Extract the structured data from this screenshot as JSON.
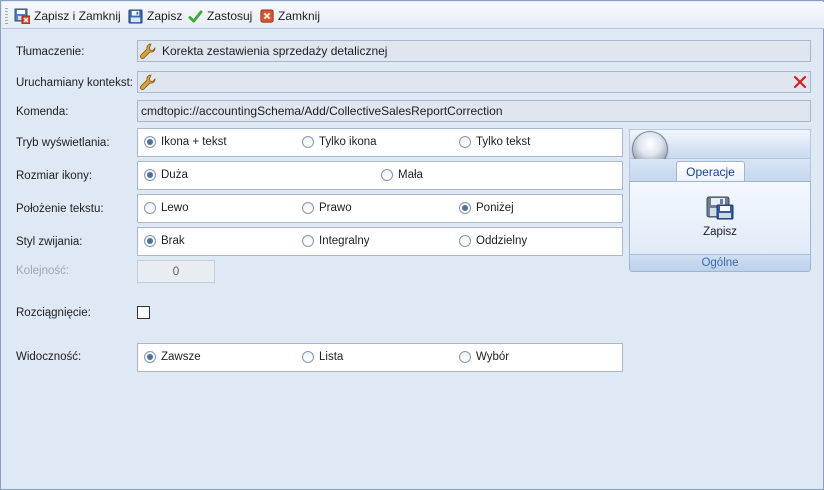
{
  "toolbar": {
    "items": [
      {
        "label": "Zapisz i Zamknij",
        "icon": "save-close-icon"
      },
      {
        "label": "Zapisz",
        "icon": "floppy-disk-icon"
      },
      {
        "label": "Zastosuj",
        "icon": "checkmark-icon"
      },
      {
        "label": "Zamknij",
        "icon": "close-icon"
      }
    ]
  },
  "form": {
    "translation": {
      "label": "Tłumaczenie:",
      "value": "Korekta zestawienia sprzedaży detalicznej"
    },
    "context": {
      "label": "Uruchamiany kontekst:",
      "value": ""
    },
    "command": {
      "label": "Komenda:",
      "value": "cmdtopic://accountingSchema/Add/CollectiveSalesReportCorrection"
    },
    "display_mode": {
      "label": "Tryb wyświetlania:",
      "options": [
        "Ikona + tekst",
        "Tylko ikona",
        "Tylko tekst"
      ],
      "selected": "Ikona + tekst"
    },
    "icon_size": {
      "label": "Rozmiar ikony:",
      "options": [
        "Duża",
        "Mała"
      ],
      "selected": "Duża"
    },
    "text_position": {
      "label": "Położenie tekstu:",
      "options": [
        "Lewo",
        "Prawo",
        "Poniżej"
      ],
      "selected": "Poniżej"
    },
    "collapse_style": {
      "label": "Styl zwijania:",
      "options": [
        "Brak",
        "Integralny",
        "Oddzielny"
      ],
      "selected": "Brak"
    },
    "order": {
      "label": "Kolejność:",
      "value": "0"
    },
    "stretch": {
      "label": "Rozciągnięcie:",
      "checked": false
    },
    "visibility": {
      "label": "Widoczność:",
      "options": [
        "Zawsze",
        "Lista",
        "Wybór"
      ],
      "selected": "Zawsze"
    }
  },
  "preview": {
    "tab": "Operacje",
    "button_label": "Zapisz",
    "group_label": "Ogólne"
  },
  "colors": {
    "accent": "#15428b",
    "background": "#dfe8f5",
    "group_label": "#3e6aaa"
  }
}
